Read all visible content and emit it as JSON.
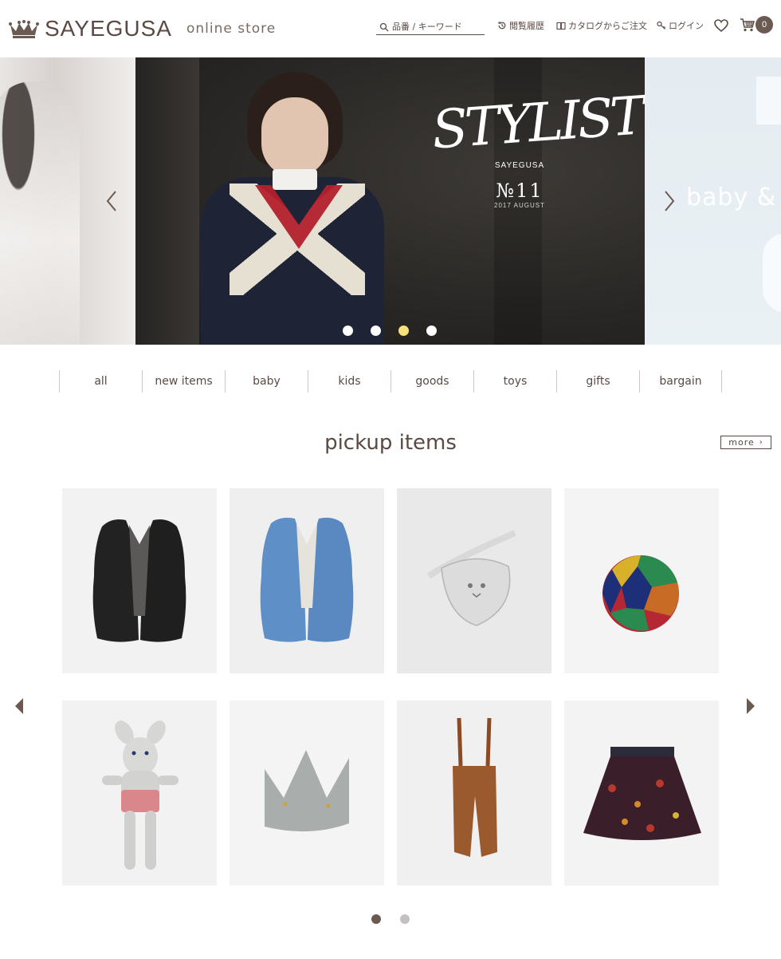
{
  "header": {
    "brand": "SAYEGUSA",
    "subtitle": "online store",
    "search_placeholder": "品番 / キーワード",
    "nav": {
      "history": "閲覧履歴",
      "catalog": "カタログからご注文",
      "login": "ログイン"
    },
    "cart_count": "0"
  },
  "hero": {
    "slide_title": "STYLIST",
    "slide_brand": "SAYEGUSA",
    "slide_issue": "№11",
    "slide_date": "2017 AUGUST",
    "next_slide_text": "baby & gi",
    "slide_count": 4,
    "active_slide": 3
  },
  "categories": [
    "all",
    "new items",
    "baby",
    "kids",
    "goods",
    "toys",
    "gifts",
    "bargain"
  ],
  "pickup": {
    "title": "pickup items",
    "more_label": "more",
    "page_count": 2,
    "active_page": 1
  },
  "colors": {
    "brand_brown": "#5b4a44",
    "active_dot": "#f6e27a"
  }
}
